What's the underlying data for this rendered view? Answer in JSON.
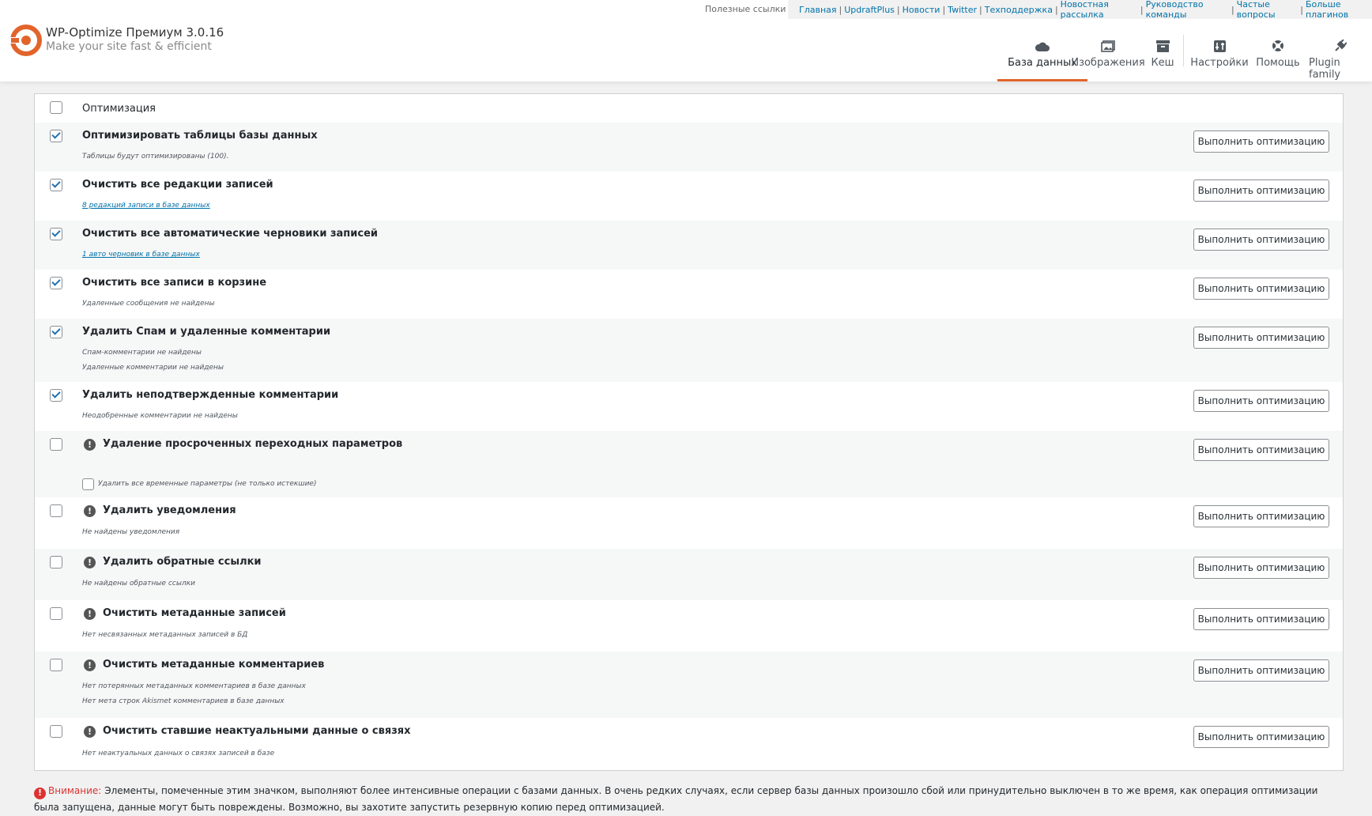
{
  "brand": {
    "title": "WP-Optimize Премиум 3.0.16",
    "subtitle": "Make your site fast & efficient",
    "accent": "#e2642b"
  },
  "top_links": {
    "label": "Полезные ссылки",
    "items": [
      "Главная",
      "UpdraftPlus",
      "Новости",
      "Twitter",
      "Техподдержка",
      "Новостная рассылка",
      "Руководство команды",
      "Частые вопросы",
      "Больше плагинов"
    ]
  },
  "tabs": [
    {
      "label": "База данных",
      "icon": "cloud-icon",
      "active": true
    },
    {
      "label": "Изображения",
      "icon": "images-icon",
      "active": false
    },
    {
      "label": "Кеш",
      "icon": "archive-icon",
      "active": false
    },
    {
      "label": "Настройки",
      "icon": "settings-icon",
      "active": false
    },
    {
      "label": "Помощь",
      "icon": "lifebuoy-icon",
      "active": false
    },
    {
      "label": "Plugin family",
      "icon": "plugin-icon",
      "active": false
    }
  ],
  "table": {
    "header_label": "Оптимизация",
    "button_label": "Выполнить оптимизацию",
    "rows": [
      {
        "title": "Оптимизировать таблицы базы данных",
        "checked": true,
        "warn": false,
        "details": [
          "Таблицы будут оптимизированы (100)."
        ]
      },
      {
        "title": "Очистить все редакции записей",
        "checked": true,
        "warn": false,
        "details": [
          "8 редакций записи в базе данных"
        ],
        "link": true
      },
      {
        "title": "Очистить все автоматические черновики записей",
        "checked": true,
        "warn": false,
        "details": [
          "1 авто черновик в базе данных"
        ],
        "link": true
      },
      {
        "title": "Очистить все записи в корзине",
        "checked": true,
        "warn": false,
        "details": [
          "Удаленные сообщения не найдены"
        ]
      },
      {
        "title": "Удалить Спам и удаленные комментарии",
        "checked": true,
        "warn": false,
        "details": [
          "Спам-комментарии не найдены",
          "Удаленные комментарии не найдены"
        ]
      },
      {
        "title": "Удалить неподтвержденные комментарии",
        "checked": true,
        "warn": false,
        "details": [
          "Неодобренные комментарии не найдены"
        ]
      },
      {
        "title": "Удаление просроченных переходных параметров",
        "checked": false,
        "warn": true,
        "details": [],
        "sub_option": "Удалить все временные параметры (не только истекшие)"
      },
      {
        "title": "Удалить уведомления",
        "checked": false,
        "warn": true,
        "details": [
          "Не найдены уведомления"
        ]
      },
      {
        "title": "Удалить обратные ссылки",
        "checked": false,
        "warn": true,
        "details": [
          "Не найдены обратные ссылки"
        ]
      },
      {
        "title": "Очистить метаданные записей",
        "checked": false,
        "warn": true,
        "details": [
          "Нет несвязанных метаданных записей в БД"
        ]
      },
      {
        "title": "Очистить метаданные комментариев",
        "checked": false,
        "warn": true,
        "details": [
          "Нет потерянных метаданных комментариев в базе данных",
          "Нет мета строк Akismet комментариев в базе данных"
        ]
      },
      {
        "title": "Очистить ставшие неактуальными данные о связях",
        "checked": false,
        "warn": true,
        "details": [
          "Нет неактуальных данных о связях записей в базе"
        ]
      }
    ]
  },
  "notice": {
    "label": "Внимание:",
    "text": "Элементы, помеченные этим значком, выполняют более интенсивные операции с базами данных. В очень редких случаях, если сервер базы данных произошло сбой или принудительно выключен в то же время, как операция оптимизации была запущена, данные могут быть повреждены. Возможно, вы захотите запустить резервную копию перед оптимизацией."
  }
}
